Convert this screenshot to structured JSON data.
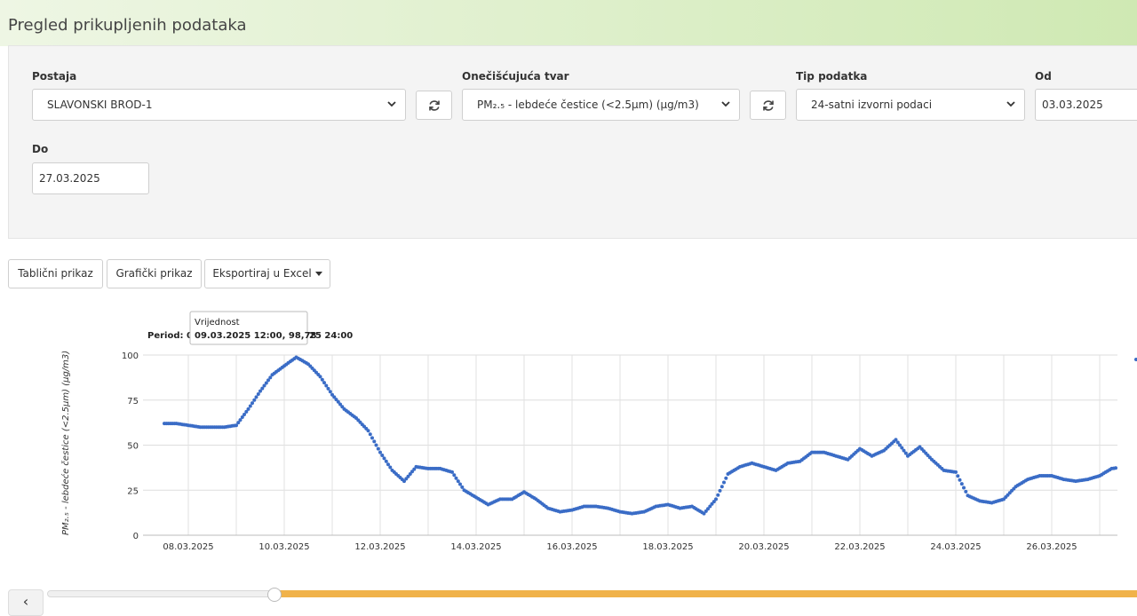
{
  "page": {
    "title": "Pregled prikupljenih podataka"
  },
  "filters": {
    "station": {
      "label": "Postaja",
      "value": "SLAVONSKI BROD-1"
    },
    "pollutant": {
      "label": "Onečišćujuća tvar",
      "value": "PM₂.₅ - lebdeće čestice (<2.5µm) (µg/m3)"
    },
    "data_type": {
      "label": "Tip podatka",
      "value": "24-satni izvorni podaci"
    },
    "from": {
      "label": "Od",
      "value": "03.03.2025"
    },
    "to": {
      "label": "Do",
      "value": "27.03.2025"
    }
  },
  "toolbar": {
    "table_view": "Tablični prikaz",
    "chart_view": "Grafički prikaz",
    "export": "Eksportiraj u Excel"
  },
  "chart": {
    "period_label": "Period: 0",
    "period_tail": "25 24:00",
    "tooltip": {
      "title": "Vrijednost",
      "value": "09.03.2025 12:00, 98,78"
    }
  },
  "icons": {
    "refresh": "refresh-icon",
    "chevron": "chevron-down-icon",
    "prev": "chevron-left-icon"
  },
  "colors": {
    "series": "#3a6cc6",
    "slider": "#f0b24a"
  },
  "chart_data": {
    "type": "scatter",
    "ylabel": "PM₂.₅ - lebdeće čestice (<2.5µm) (µg/m3)",
    "ylim": [
      0,
      100
    ],
    "yticks": [
      0,
      25,
      50,
      75,
      100
    ],
    "xticks": [
      "08.03.2025",
      "10.03.2025",
      "12.03.2025",
      "14.03.2025",
      "16.03.2025",
      "18.03.2025",
      "20.03.2025",
      "22.03.2025",
      "24.03.2025",
      "26.03.2025"
    ],
    "grid": true,
    "series": [
      {
        "values": [
          [
            "07.03.2025 12:00",
            62
          ],
          [
            "07.03.2025 18:00",
            62
          ],
          [
            "08.03.2025 00:00",
            61
          ],
          [
            "08.03.2025 06:00",
            60
          ],
          [
            "08.03.2025 12:00",
            60
          ],
          [
            "08.03.2025 18:00",
            60
          ],
          [
            "09.03.2025 00:00",
            61
          ],
          [
            "09.03.2025 06:00",
            70
          ],
          [
            "09.03.2025 12:00",
            80
          ],
          [
            "09.03.2025 18:00",
            89
          ],
          [
            "10.03.2025 00:00",
            94
          ],
          [
            "10.03.2025 06:00",
            98.78
          ],
          [
            "10.03.2025 12:00",
            95
          ],
          [
            "10.03.2025 18:00",
            88
          ],
          [
            "11.03.2025 00:00",
            78
          ],
          [
            "11.03.2025 06:00",
            70
          ],
          [
            "11.03.2025 12:00",
            65
          ],
          [
            "11.03.2025 18:00",
            58
          ],
          [
            "12.03.2025 00:00",
            46
          ],
          [
            "12.03.2025 06:00",
            36
          ],
          [
            "12.03.2025 12:00",
            30
          ],
          [
            "12.03.2025 18:00",
            38
          ],
          [
            "13.03.2025 00:00",
            37
          ],
          [
            "13.03.2025 06:00",
            37
          ],
          [
            "13.03.2025 12:00",
            35
          ],
          [
            "13.03.2025 18:00",
            25
          ],
          [
            "14.03.2025 00:00",
            21
          ],
          [
            "14.03.2025 06:00",
            17
          ],
          [
            "14.03.2025 12:00",
            20
          ],
          [
            "14.03.2025 18:00",
            20
          ],
          [
            "15.03.2025 00:00",
            24
          ],
          [
            "15.03.2025 06:00",
            20
          ],
          [
            "15.03.2025 12:00",
            15
          ],
          [
            "15.03.2025 18:00",
            13
          ],
          [
            "16.03.2025 00:00",
            14
          ],
          [
            "16.03.2025 06:00",
            16
          ],
          [
            "16.03.2025 12:00",
            16
          ],
          [
            "16.03.2025 18:00",
            15
          ],
          [
            "17.03.2025 00:00",
            13
          ],
          [
            "17.03.2025 06:00",
            12
          ],
          [
            "17.03.2025 12:00",
            13
          ],
          [
            "17.03.2025 18:00",
            16
          ],
          [
            "18.03.2025 00:00",
            17
          ],
          [
            "18.03.2025 06:00",
            15
          ],
          [
            "18.03.2025 12:00",
            16
          ],
          [
            "18.03.2025 18:00",
            12
          ],
          [
            "19.03.2025 00:00",
            20
          ],
          [
            "19.03.2025 06:00",
            34
          ],
          [
            "19.03.2025 12:00",
            38
          ],
          [
            "19.03.2025 18:00",
            40
          ],
          [
            "20.03.2025 00:00",
            38
          ],
          [
            "20.03.2025 06:00",
            36
          ],
          [
            "20.03.2025 12:00",
            40
          ],
          [
            "20.03.2025 18:00",
            41
          ],
          [
            "21.03.2025 00:00",
            46
          ],
          [
            "21.03.2025 06:00",
            46
          ],
          [
            "21.03.2025 12:00",
            44
          ],
          [
            "21.03.2025 18:00",
            42
          ],
          [
            "22.03.2025 00:00",
            48
          ],
          [
            "22.03.2025 06:00",
            44
          ],
          [
            "22.03.2025 12:00",
            47
          ],
          [
            "22.03.2025 18:00",
            53
          ],
          [
            "23.03.2025 00:00",
            44
          ],
          [
            "23.03.2025 06:00",
            49
          ],
          [
            "23.03.2025 12:00",
            42
          ],
          [
            "23.03.2025 18:00",
            36
          ],
          [
            "24.03.2025 00:00",
            35
          ],
          [
            "24.03.2025 06:00",
            22
          ],
          [
            "24.03.2025 12:00",
            19
          ],
          [
            "24.03.2025 18:00",
            18
          ],
          [
            "25.03.2025 00:00",
            20
          ],
          [
            "25.03.2025 06:00",
            27
          ],
          [
            "25.03.2025 12:00",
            31
          ],
          [
            "25.03.2025 18:00",
            33
          ],
          [
            "26.03.2025 00:00",
            33
          ],
          [
            "26.03.2025 06:00",
            31
          ],
          [
            "26.03.2025 12:00",
            30
          ],
          [
            "26.03.2025 18:00",
            31
          ],
          [
            "27.03.2025 00:00",
            33
          ],
          [
            "27.03.2025 06:00",
            37
          ],
          [
            "27.03.2025 12:00",
            38
          ]
        ]
      }
    ]
  }
}
